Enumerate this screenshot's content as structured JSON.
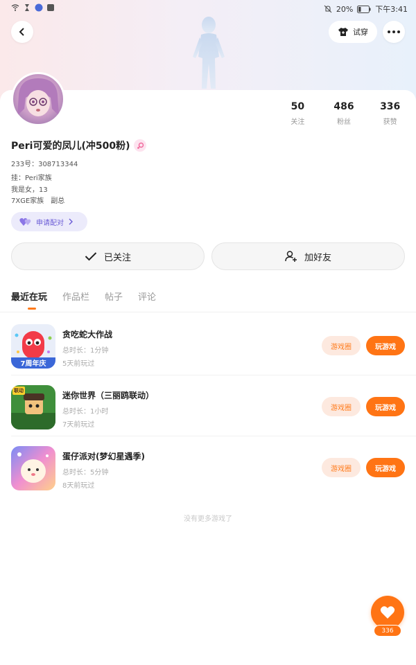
{
  "status_bar": {
    "battery": "20%",
    "time": "下午3:41",
    "left_icons": [
      "wifi-icon",
      "hourglass-icon",
      "app-notification-icon",
      "gallery-icon"
    ],
    "right_icons": [
      "mute-icon",
      "battery-icon"
    ]
  },
  "header": {
    "try_on_label": "试穿"
  },
  "profile": {
    "stats": [
      {
        "value": "50",
        "label": "关注"
      },
      {
        "value": "486",
        "label": "粉丝"
      },
      {
        "value": "336",
        "label": "获赞"
      }
    ],
    "name": "Peri可爱的凤儿(冲500粉)",
    "uid": "233号：308713344",
    "bio_lines": [
      "挂：Peri家族",
      "我是女，13",
      "7XGE家族　副总"
    ],
    "pair_label": "申请配对"
  },
  "actions": {
    "followed_label": "已关注",
    "add_friend_label": "加好友"
  },
  "tabs": [
    {
      "label": "最近在玩",
      "active": true
    },
    {
      "label": "作品栏",
      "active": false
    },
    {
      "label": "帖子",
      "active": false
    },
    {
      "label": "评论",
      "active": false
    }
  ],
  "games": [
    {
      "name": "贪吃蛇大作战",
      "duration": "总时长：1分钟",
      "last_played": "5天前玩过",
      "circle_label": "游戏圈",
      "play_label": "玩游戏",
      "icon_text": "7周年庆"
    },
    {
      "name": "迷你世界（三丽鸥联动）",
      "duration": "总时长：1小时",
      "last_played": "7天前玩过",
      "circle_label": "游戏圈",
      "play_label": "玩游戏",
      "icon_text": "联动"
    },
    {
      "name": "蛋仔派对(梦幻星遇季)",
      "duration": "总时长：5分钟",
      "last_played": "8天前玩过",
      "circle_label": "游戏圈",
      "play_label": "玩游戏",
      "icon_text": ""
    }
  ],
  "footer": {
    "no_more": "没有更多游戏了",
    "like_count": "336"
  },
  "colors": {
    "accent": "#ff7414",
    "accent_soft": "#fde9df",
    "pair": "#6a5bd6"
  }
}
